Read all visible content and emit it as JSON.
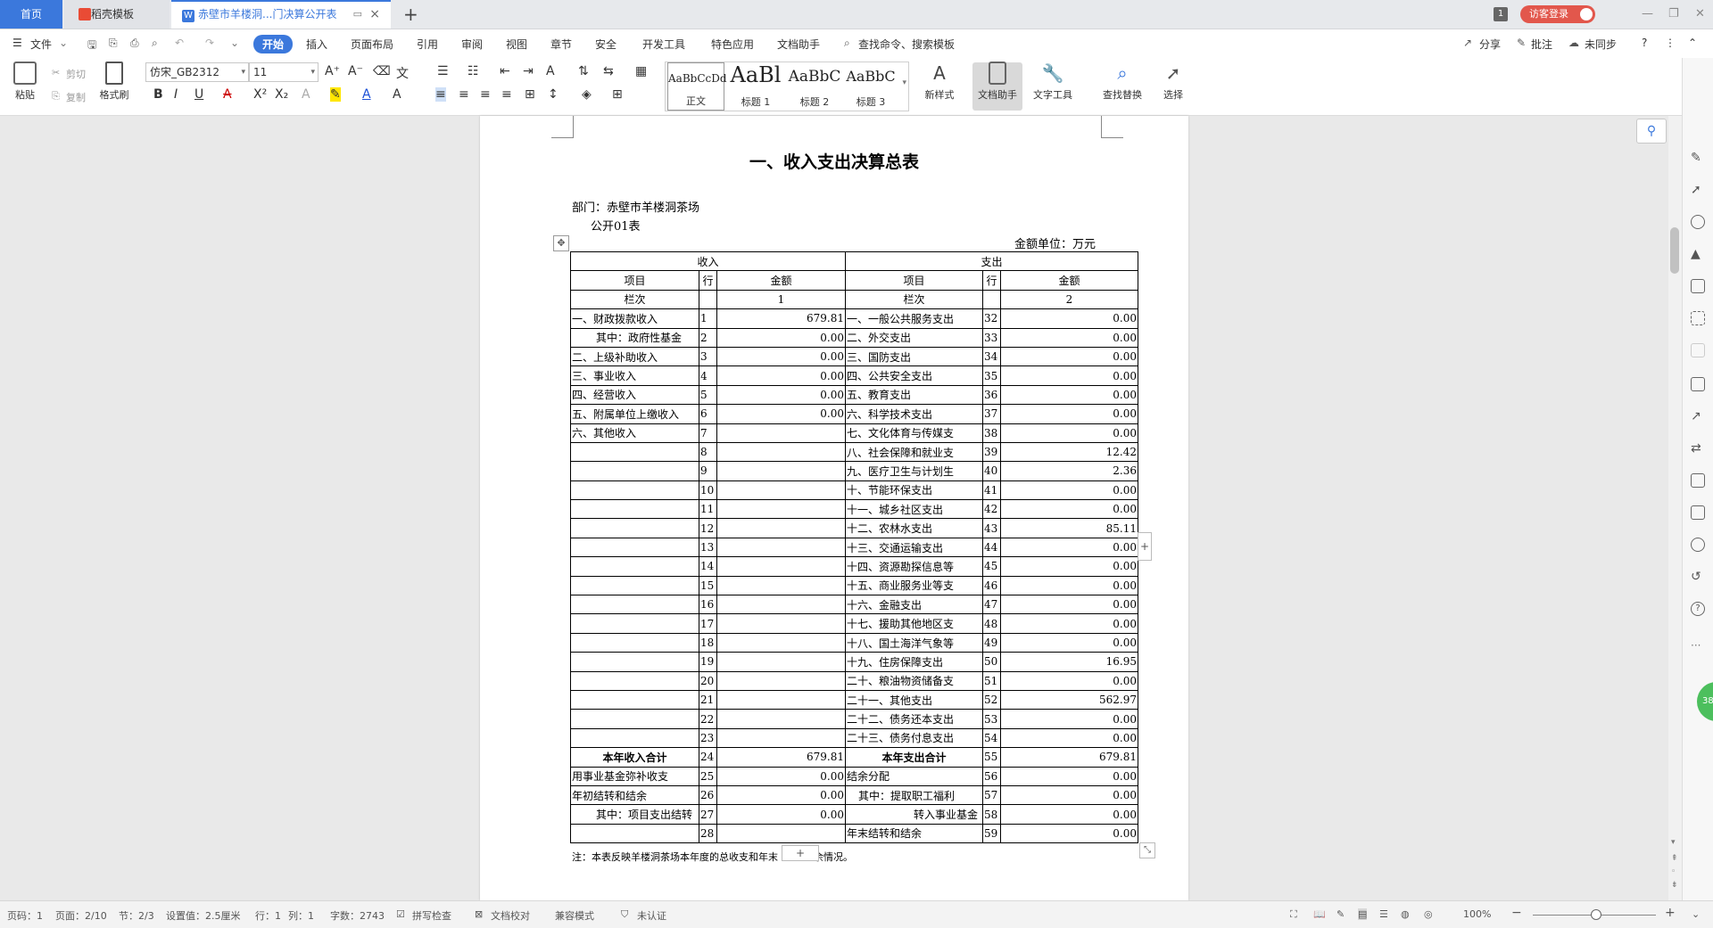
{
  "tabs": {
    "home": "首页",
    "daoke": "稻壳模板",
    "doc": "赤壁市羊楼洞...门决算公开表",
    "add": "+"
  },
  "titlebar": {
    "badge": "1",
    "login": "访客登录",
    "min": "—",
    "restore": "❐",
    "close": "✕"
  },
  "menubar": {
    "file": "文件",
    "items": [
      "开始",
      "插入",
      "页面布局",
      "引用",
      "审阅",
      "视图",
      "章节",
      "安全",
      "开发工具",
      "特色应用",
      "文档助手"
    ],
    "search": "查找命令、搜索模板",
    "share": "分享",
    "comment": "批注",
    "sync": "未同步",
    "help": "?"
  },
  "ribbon": {
    "paste": "粘贴",
    "cut": "剪切",
    "copy": "复制",
    "format_painter": "格式刷",
    "font_name": "仿宋_GB2312",
    "font_size": "11",
    "styles": [
      {
        "preview": "AaBbCcDd",
        "name": "正文"
      },
      {
        "preview": "AaBl",
        "name": "标题 1"
      },
      {
        "preview": "AaBbC",
        "name": "标题 2"
      },
      {
        "preview": "AaBbC",
        "name": "标题 3"
      }
    ],
    "new_style": "新样式",
    "doc_assistant": "文档助手",
    "text_tools": "文字工具",
    "find_replace": "查找替换",
    "select": "选择"
  },
  "document": {
    "title": "一、收入支出决算总表",
    "dept": "部门：赤壁市羊楼洞茶场",
    "form_no": "公开01表",
    "unit": "金额单位：万元",
    "header": {
      "income": "收入",
      "expense": "支出",
      "item": "项目",
      "row": "行",
      "amount": "金额",
      "col": "栏次",
      "col1": "1",
      "col2": "2"
    },
    "rows": [
      {
        "il": "一、财政拨款收入",
        "ir": "1",
        "ia": "679.81",
        "el": "一、一般公共服务支出",
        "er": "32",
        "ea": "0.00"
      },
      {
        "il": "其中：政府性基金",
        "ir": "2",
        "ia": "0.00",
        "el": "二、外交支出",
        "er": "33",
        "ea": "0.00"
      },
      {
        "il": "二、上级补助收入",
        "ir": "3",
        "ia": "0.00",
        "el": "三、国防支出",
        "er": "34",
        "ea": "0.00"
      },
      {
        "il": "三、事业收入",
        "ir": "4",
        "ia": "0.00",
        "el": "四、公共安全支出",
        "er": "35",
        "ea": "0.00"
      },
      {
        "il": "四、经营收入",
        "ir": "5",
        "ia": "0.00",
        "el": "五、教育支出",
        "er": "36",
        "ea": "0.00"
      },
      {
        "il": "五、附属单位上缴收入",
        "ir": "6",
        "ia": "0.00",
        "el": "六、科学技术支出",
        "er": "37",
        "ea": "0.00"
      },
      {
        "il": "六、其他收入",
        "ir": "7",
        "ia": "",
        "el": "七、文化体育与传媒支",
        "er": "38",
        "ea": "0.00"
      },
      {
        "il": "",
        "ir": "8",
        "ia": "",
        "el": "八、社会保障和就业支",
        "er": "39",
        "ea": "12.42"
      },
      {
        "il": "",
        "ir": "9",
        "ia": "",
        "el": "九、医疗卫生与计划生",
        "er": "40",
        "ea": "2.36"
      },
      {
        "il": "",
        "ir": "10",
        "ia": "",
        "el": "十、节能环保支出",
        "er": "41",
        "ea": "0.00"
      },
      {
        "il": "",
        "ir": "11",
        "ia": "",
        "el": "十一、城乡社区支出",
        "er": "42",
        "ea": "0.00"
      },
      {
        "il": "",
        "ir": "12",
        "ia": "",
        "el": "十二、农林水支出",
        "er": "43",
        "ea": "85.11"
      },
      {
        "il": "",
        "ir": "13",
        "ia": "",
        "el": "十三、交通运输支出",
        "er": "44",
        "ea": "0.00"
      },
      {
        "il": "",
        "ir": "14",
        "ia": "",
        "el": "十四、资源勘探信息等",
        "er": "45",
        "ea": "0.00"
      },
      {
        "il": "",
        "ir": "15",
        "ia": "",
        "el": "十五、商业服务业等支",
        "er": "46",
        "ea": "0.00"
      },
      {
        "il": "",
        "ir": "16",
        "ia": "",
        "el": "十六、金融支出",
        "er": "47",
        "ea": "0.00"
      },
      {
        "il": "",
        "ir": "17",
        "ia": "",
        "el": "十七、援助其他地区支",
        "er": "48",
        "ea": "0.00"
      },
      {
        "il": "",
        "ir": "18",
        "ia": "",
        "el": "十八、国土海洋气象等",
        "er": "49",
        "ea": "0.00"
      },
      {
        "il": "",
        "ir": "19",
        "ia": "",
        "el": "十九、住房保障支出",
        "er": "50",
        "ea": "16.95"
      },
      {
        "il": "",
        "ir": "20",
        "ia": "",
        "el": "二十、粮油物资储备支",
        "er": "51",
        "ea": "0.00"
      },
      {
        "il": "",
        "ir": "21",
        "ia": "",
        "el": "二十一、其他支出",
        "er": "52",
        "ea": "562.97"
      },
      {
        "il": "",
        "ir": "22",
        "ia": "",
        "el": "二十二、债务还本支出",
        "er": "53",
        "ea": "0.00"
      },
      {
        "il": "",
        "ir": "23",
        "ia": "",
        "el": "二十三、债务付息支出",
        "er": "54",
        "ea": "0.00"
      },
      {
        "il": "本年收入合计",
        "ir": "24",
        "ia": "679.81",
        "el": "本年支出合计",
        "er": "55",
        "ea": "679.81",
        "bold": true
      },
      {
        "il": "用事业基金弥补收支",
        "ir": "25",
        "ia": "0.00",
        "el": "结余分配",
        "er": "56",
        "ea": "0.00"
      },
      {
        "il": "年初结转和结余",
        "ir": "26",
        "ia": "0.00",
        "el": "其中：提取职工福利",
        "er": "57",
        "ea": "0.00"
      },
      {
        "il": "其中：项目支出结转",
        "ir": "27",
        "ia": "0.00",
        "el": "转入事业基金",
        "er": "58",
        "ea": "0.00"
      },
      {
        "il": "",
        "ir": "28",
        "ia": "",
        "el": "年末结转和结余",
        "er": "59",
        "ea": "0.00"
      }
    ],
    "note_left": "注：本表反映羊楼洞茶场本年度的总收支和年末",
    "note_right": "余情况。"
  },
  "status": {
    "page_code": "页码：1",
    "pages": "页面：2/10",
    "section": "节：2/3",
    "setting": "设置值：2.5厘米",
    "line": "行：1",
    "col": "列：1",
    "words": "字数：2743",
    "spell": "拼写检查",
    "proof": "文档校对",
    "compat": "兼容模式",
    "cert": "未认证",
    "zoom": "100%"
  },
  "colors": {
    "accent": "#3b78dc",
    "login": "#e2574c",
    "assistant": "#4cbf5d"
  },
  "float_badge": "38"
}
